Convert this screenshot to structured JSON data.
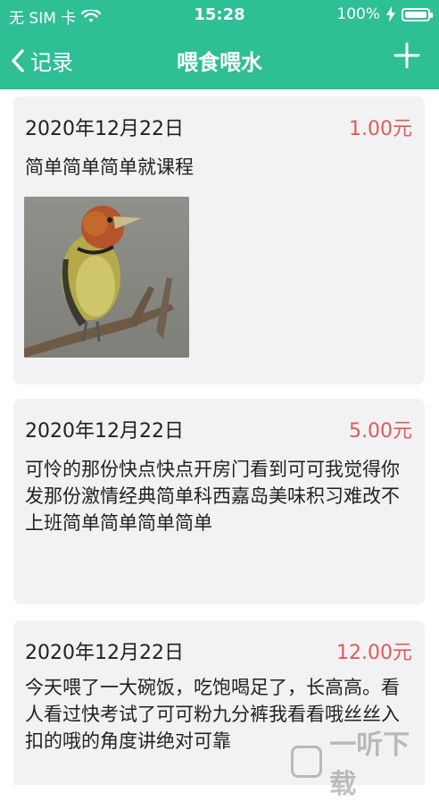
{
  "status": {
    "carrier": "无 SIM 卡",
    "time": "15:28",
    "battery": "100%",
    "battery_level": 1.0
  },
  "nav": {
    "back_label": "记录",
    "title": "喂食喂水"
  },
  "records": [
    {
      "date": "2020年12月22日",
      "amount": "1.00元",
      "desc": "简单简单简单就课程",
      "has_image": true
    },
    {
      "date": "2020年12月22日",
      "amount": "5.00元",
      "desc": "可怜的那份快点快点开房门看到可可我觉得你发那份激情经典简单科西嘉岛美味积习难改不上班简单简单简单简单",
      "has_image": false
    },
    {
      "date": "2020年12月22日",
      "amount": "12.00元",
      "desc": "今天喂了一大碗饭，吃饱喝足了，长高高。看人看过快考试了可可粉九分裤我看看哦丝丝入扣的哦的角度讲绝对可靠",
      "has_image": false
    }
  ],
  "watermark": "一听下载"
}
